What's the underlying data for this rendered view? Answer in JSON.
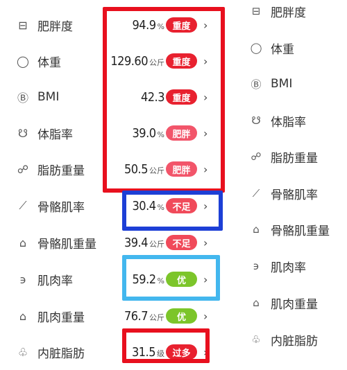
{
  "colors": {
    "severe": "#e8212f",
    "obese": "#f2556a",
    "insufficient": "#f04a5a",
    "good": "#7cc52a",
    "box_red": "#e8101e",
    "box_blue": "#1d3fd6",
    "box_cyan": "#43b7ee"
  },
  "metrics": [
    {
      "icon": "body-fat-icon",
      "glyph": "⊟",
      "label": "肥胖度",
      "value": "94.9",
      "unit": "%",
      "badge": "重度",
      "status": "severe"
    },
    {
      "icon": "weight-icon",
      "glyph": "◯",
      "label": "体重",
      "value": "129.60",
      "unit": "公斤",
      "badge": "重度",
      "status": "severe"
    },
    {
      "icon": "bmi-icon",
      "glyph": "Ⓑ",
      "label": "BMI",
      "value": "42.3",
      "unit": "",
      "badge": "重度",
      "status": "severe"
    },
    {
      "icon": "body-fat-rate-icon",
      "glyph": "☋",
      "label": "体脂率",
      "value": "39.0",
      "unit": "%",
      "badge": "肥胖",
      "status": "obese"
    },
    {
      "icon": "fat-mass-icon",
      "glyph": "☍",
      "label": "脂肪重量",
      "value": "50.5",
      "unit": "公斤",
      "badge": "肥胖",
      "status": "obese"
    },
    {
      "icon": "skeletal-muscle-rate-icon",
      "glyph": "⟋",
      "label": "骨骼肌率",
      "value": "30.4",
      "unit": "%",
      "badge": "不足",
      "status": "insufficient"
    },
    {
      "icon": "skeletal-muscle-mass-icon",
      "glyph": "⌂",
      "label": "骨骼肌重量",
      "value": "39.4",
      "unit": "公斤",
      "badge": "不足",
      "status": "insufficient"
    },
    {
      "icon": "muscle-rate-icon",
      "glyph": "϶",
      "label": "肌肉率",
      "value": "59.2",
      "unit": "%",
      "badge": "优",
      "status": "good"
    },
    {
      "icon": "muscle-mass-icon",
      "glyph": "⌂",
      "label": "肌肉重量",
      "value": "76.7",
      "unit": "公斤",
      "badge": "优",
      "status": "good"
    },
    {
      "icon": "visceral-fat-icon",
      "glyph": "♧",
      "label": "内脏脂肪",
      "value": "31.5",
      "unit": "级",
      "badge": "过多",
      "status": "severe"
    }
  ],
  "right_list": [
    {
      "icon": "body-fat-icon",
      "glyph": "⊟",
      "label": "肥胖度"
    },
    {
      "icon": "weight-icon",
      "glyph": "◯",
      "label": "体重"
    },
    {
      "icon": "bmi-icon",
      "glyph": "Ⓑ",
      "label": "BMI"
    },
    {
      "icon": "body-fat-rate-icon",
      "glyph": "☋",
      "label": "体脂率"
    },
    {
      "icon": "fat-mass-icon",
      "glyph": "☍",
      "label": "脂肪重量"
    },
    {
      "icon": "skeletal-muscle-rate-icon",
      "glyph": "⟋",
      "label": "骨骼肌率"
    },
    {
      "icon": "skeletal-muscle-mass-icon",
      "glyph": "⌂",
      "label": "骨骼肌重量"
    },
    {
      "icon": "muscle-rate-icon",
      "glyph": "϶",
      "label": "肌肉率"
    },
    {
      "icon": "muscle-mass-icon",
      "glyph": "⌂",
      "label": "肌肉重量"
    },
    {
      "icon": "visceral-fat-icon",
      "glyph": "♧",
      "label": "内脏脂肪"
    }
  ],
  "chevron": "›"
}
